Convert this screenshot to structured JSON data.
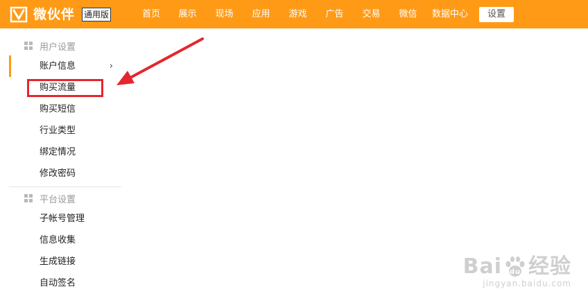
{
  "header": {
    "logo_text": "微伙伴",
    "logo_badge": "通用版",
    "nav": [
      "首页",
      "展示",
      "现场",
      "应用",
      "游戏",
      "广告",
      "交易",
      "微信",
      "数据中心"
    ],
    "active_nav": "设置"
  },
  "sidebar": {
    "group1": {
      "title": "用户设置",
      "items": [
        "账户信息",
        "购买流量",
        "购买短信",
        "行业类型",
        "绑定情况",
        "修改密码"
      ]
    },
    "group2": {
      "title": "平台设置",
      "items": [
        "子帐号管理",
        "信息收集",
        "生成链接",
        "自动签名"
      ]
    }
  },
  "watermark": {
    "logo_left": "Bai",
    "logo_right": "经验",
    "url": "jingyan.baidu.com"
  },
  "colors": {
    "header_bg": "#ff9a16",
    "highlight": "#e5262e",
    "active_indicator": "#ff9a16"
  }
}
